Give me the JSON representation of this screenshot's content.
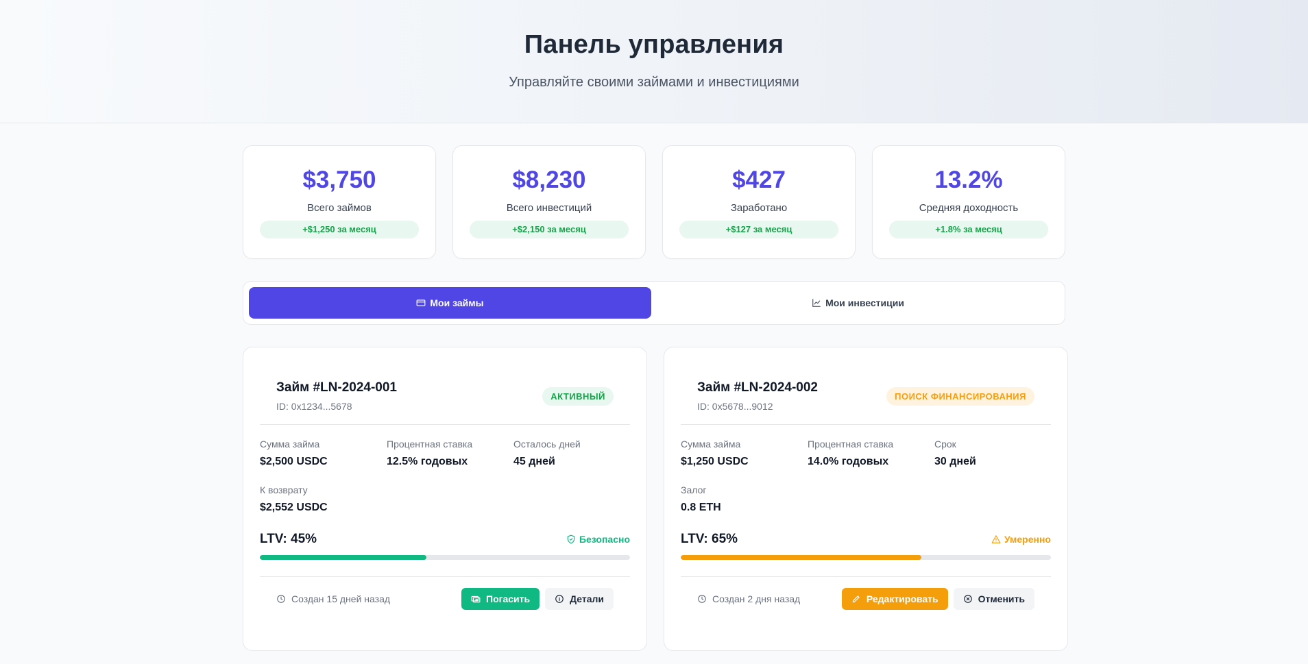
{
  "header": {
    "title": "Панель управления",
    "subtitle": "Управляйте своими займами и инвестициями"
  },
  "stats": [
    {
      "value": "$3,750",
      "label": "Всего займов",
      "delta": "+$1,250 за месяц"
    },
    {
      "value": "$8,230",
      "label": "Всего инвестиций",
      "delta": "+$2,150 за месяц"
    },
    {
      "value": "$427",
      "label": "Заработано",
      "delta": "+$127 за месяц"
    },
    {
      "value": "13.2%",
      "label": "Средняя доходность",
      "delta": "+1.8% за месяц"
    }
  ],
  "tabs": [
    {
      "label": "Мои займы",
      "icon": "credit-card-icon",
      "active": true
    },
    {
      "label": "Мои инвестиции",
      "icon": "chart-line-icon",
      "active": false
    }
  ],
  "loans": [
    {
      "title": "Займ #LN-2024-001",
      "id": "ID: 0x1234...5678",
      "status": "АКТИВНЫЙ",
      "fields": [
        {
          "label": "Сумма займа",
          "value": "$2,500 USDC"
        },
        {
          "label": "Процентная ставка",
          "value": "12.5% годовых"
        },
        {
          "label": "Осталось дней",
          "value": "45 дней"
        },
        {
          "label": "К возврату",
          "value": "$2,552 USDC"
        }
      ],
      "ltv_label": "LTV: 45%",
      "ltv_value": 45,
      "ltv_status": "Безопасно",
      "ltv_color": "#10b981",
      "created": "Создан 15 дней назад",
      "primary_button": "Погасить",
      "secondary_button": "Детали"
    },
    {
      "title": "Займ #LN-2024-002",
      "id": "ID: 0x5678...9012",
      "status": "ПОИСК ФИНАНСИРОВАНИЯ",
      "fields": [
        {
          "label": "Сумма займа",
          "value": "$1,250 USDC"
        },
        {
          "label": "Процентная ставка",
          "value": "14.0% годовых"
        },
        {
          "label": "Срок",
          "value": "30 дней"
        },
        {
          "label": "Залог",
          "value": "0.8 ETH"
        }
      ],
      "ltv_label": "LTV: 65%",
      "ltv_value": 65,
      "ltv_status": "Умеренно",
      "ltv_color": "#f59e0b",
      "created": "Создан 2 дня назад",
      "primary_button": "Редактировать",
      "secondary_button": "Отменить"
    }
  ],
  "colors": {
    "accent": "#4f46e5",
    "success": "#10b981",
    "warning": "#f59e0b"
  }
}
